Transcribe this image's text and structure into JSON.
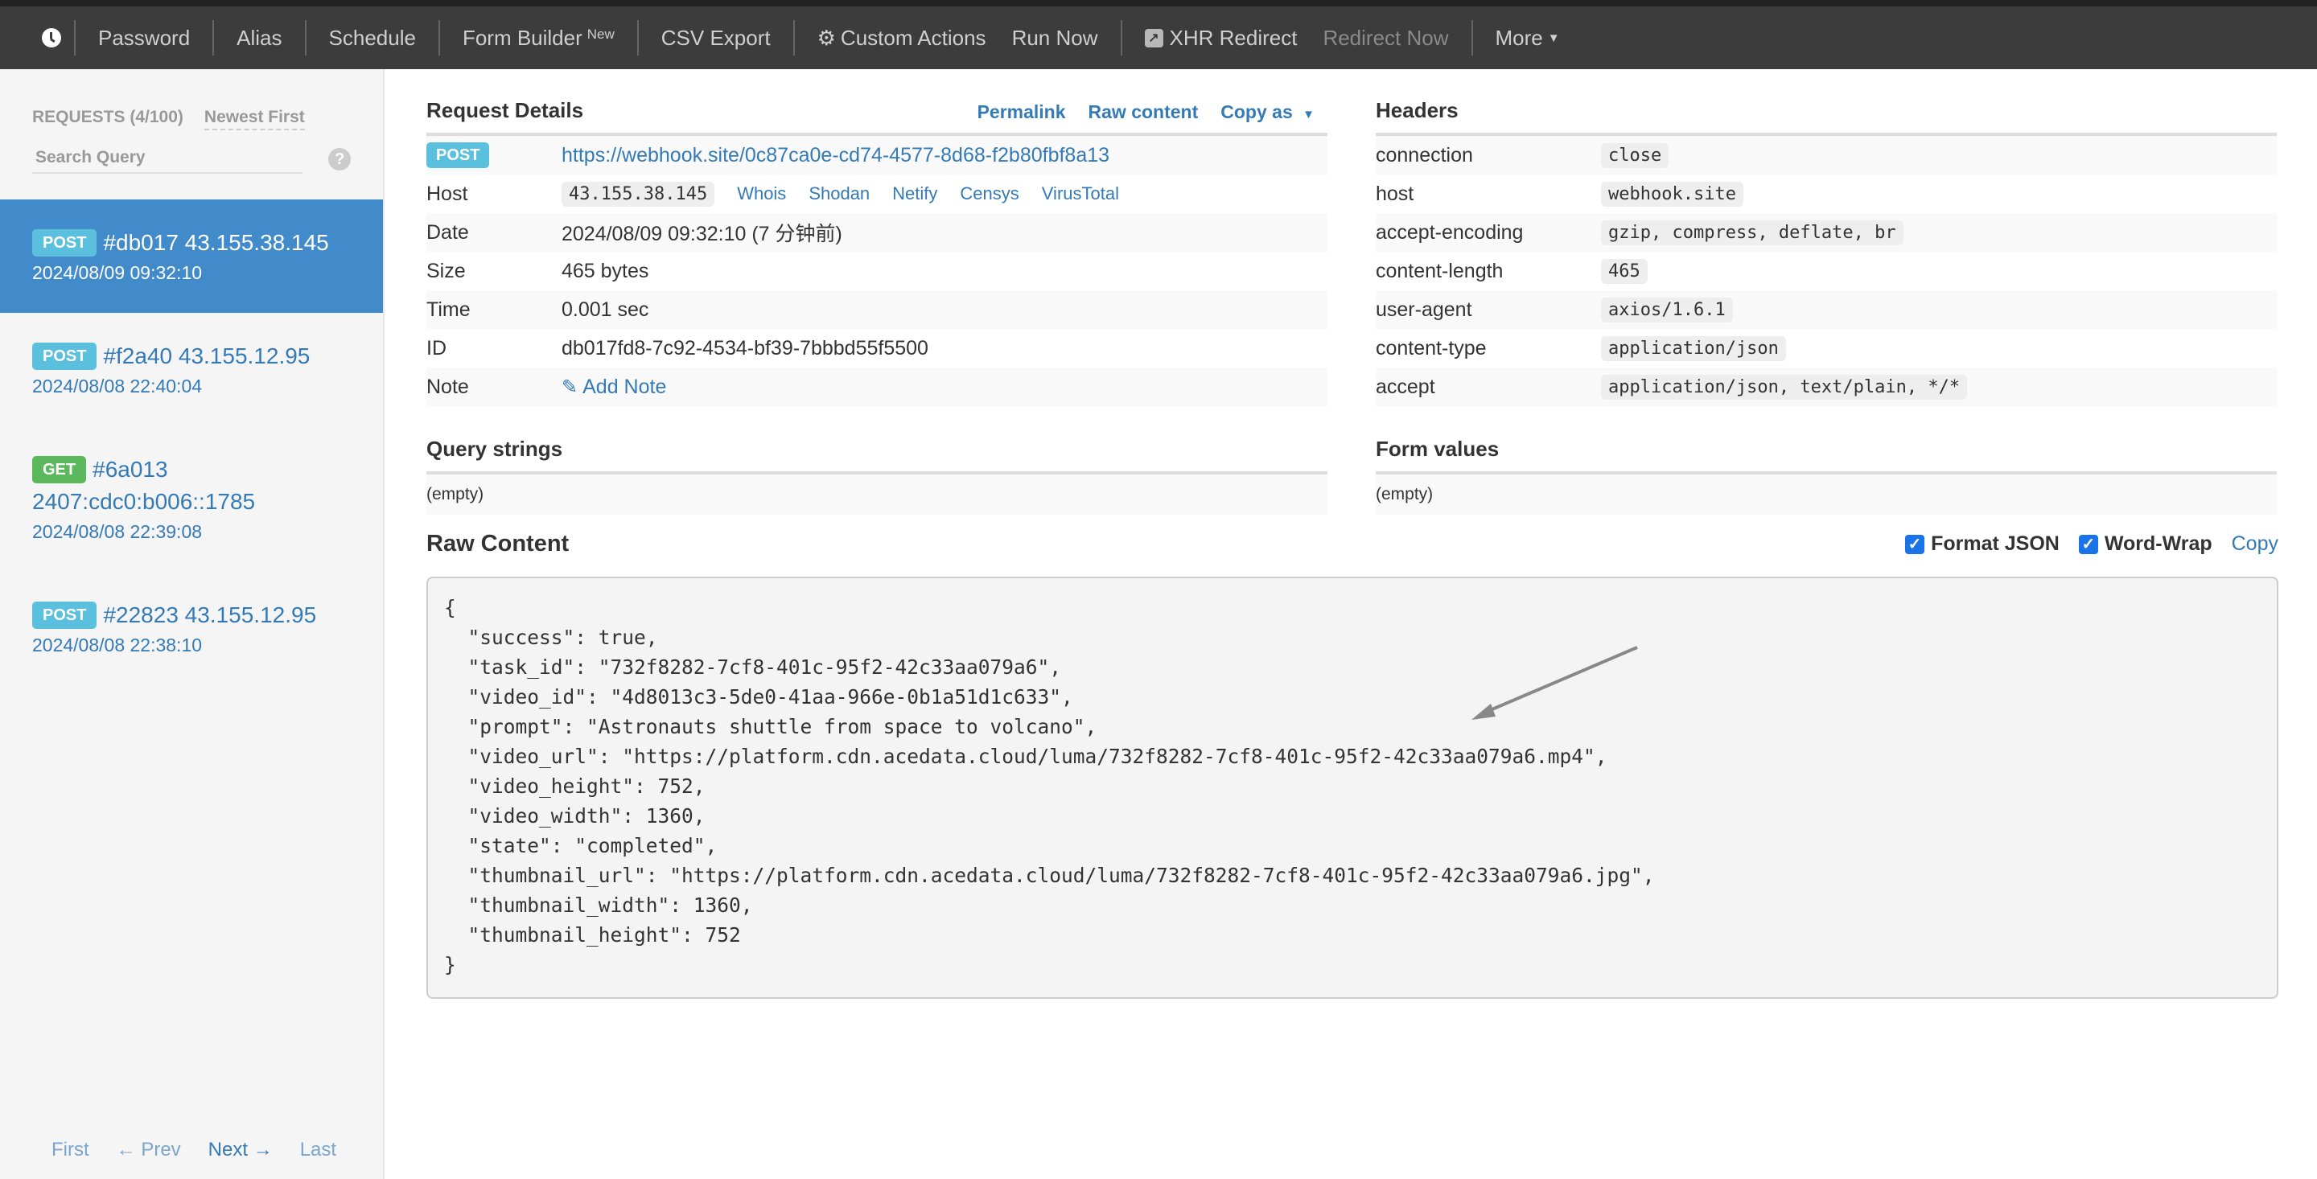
{
  "navbar": {
    "items": [
      {
        "label": "Password"
      },
      {
        "label": "Alias"
      },
      {
        "label": "Schedule"
      },
      {
        "label": "Form Builder",
        "sup": "New"
      },
      {
        "label": "CSV Export"
      },
      {
        "label": "Custom Actions"
      },
      {
        "label": "Run Now"
      },
      {
        "label": "XHR Redirect"
      },
      {
        "label": "Redirect Now"
      },
      {
        "label": "More"
      }
    ]
  },
  "sidebar": {
    "count_label": "REQUESTS (4/100)",
    "sort_label": "Newest First",
    "search_placeholder": "Search Query",
    "help": "?",
    "requests": [
      {
        "method": "POST",
        "title": "#db017 43.155.38.145",
        "time": "2024/08/09 09:32:10",
        "active": true
      },
      {
        "method": "POST",
        "title": "#f2a40 43.155.12.95",
        "time": "2024/08/08 22:40:04"
      },
      {
        "method": "GET",
        "title": "#6a013 2407:cdc0:b006::1785",
        "time": "2024/08/08 22:39:08"
      },
      {
        "method": "POST",
        "title": "#22823 43.155.12.95",
        "time": "2024/08/08 22:38:10"
      }
    ],
    "pager": {
      "first": "First",
      "prev": "← Prev",
      "next": "Next →",
      "last": "Last"
    }
  },
  "details": {
    "title": "Request Details",
    "links": {
      "permalink": "Permalink",
      "raw": "Raw content",
      "copy_as": "Copy as"
    },
    "method": "POST",
    "url": "https://webhook.site/0c87ca0e-cd74-4577-8d68-f2b80fbf8a13",
    "host_label": "Host",
    "host": "43.155.38.145",
    "host_links": [
      "Whois",
      "Shodan",
      "Netify",
      "Censys",
      "VirusTotal"
    ],
    "date_label": "Date",
    "date": "2024/08/09 09:32:10 (7 分钟前)",
    "size_label": "Size",
    "size": "465 bytes",
    "time_label": "Time",
    "time": "0.001 sec",
    "id_label": "ID",
    "id": "db017fd8-7c92-4534-bf39-7bbbd55f5500",
    "note_label": "Note",
    "add_note": "Add Note"
  },
  "headers": {
    "title": "Headers",
    "rows": [
      {
        "k": "connection",
        "v": "close"
      },
      {
        "k": "host",
        "v": "webhook.site"
      },
      {
        "k": "accept-encoding",
        "v": "gzip, compress, deflate, br"
      },
      {
        "k": "content-length",
        "v": "465"
      },
      {
        "k": "user-agent",
        "v": "axios/1.6.1"
      },
      {
        "k": "content-type",
        "v": "application/json"
      },
      {
        "k": "accept",
        "v": "application/json, text/plain, */*"
      }
    ]
  },
  "query": {
    "title": "Query strings",
    "empty": "(empty)"
  },
  "form": {
    "title": "Form values",
    "empty": "(empty)"
  },
  "raw": {
    "title": "Raw Content",
    "format_json": "Format JSON",
    "format_json_checked": true,
    "word_wrap": "Word-Wrap",
    "word_wrap_checked": true,
    "copy": "Copy",
    "content": "{\n  \"success\": true,\n  \"task_id\": \"732f8282-7cf8-401c-95f2-42c33aa079a6\",\n  \"video_id\": \"4d8013c3-5de0-41aa-966e-0b1a51d1c633\",\n  \"prompt\": \"Astronauts shuttle from space to volcano\",\n  \"video_url\": \"https://platform.cdn.acedata.cloud/luma/732f8282-7cf8-401c-95f2-42c33aa079a6.mp4\",\n  \"video_height\": 752,\n  \"video_width\": 1360,\n  \"state\": \"completed\",\n  \"thumbnail_url\": \"https://platform.cdn.acedata.cloud/luma/732f8282-7cf8-401c-95f2-42c33aa079a6.jpg\",\n  \"thumbnail_width\": 1360,\n  \"thumbnail_height\": 752\n}"
  }
}
